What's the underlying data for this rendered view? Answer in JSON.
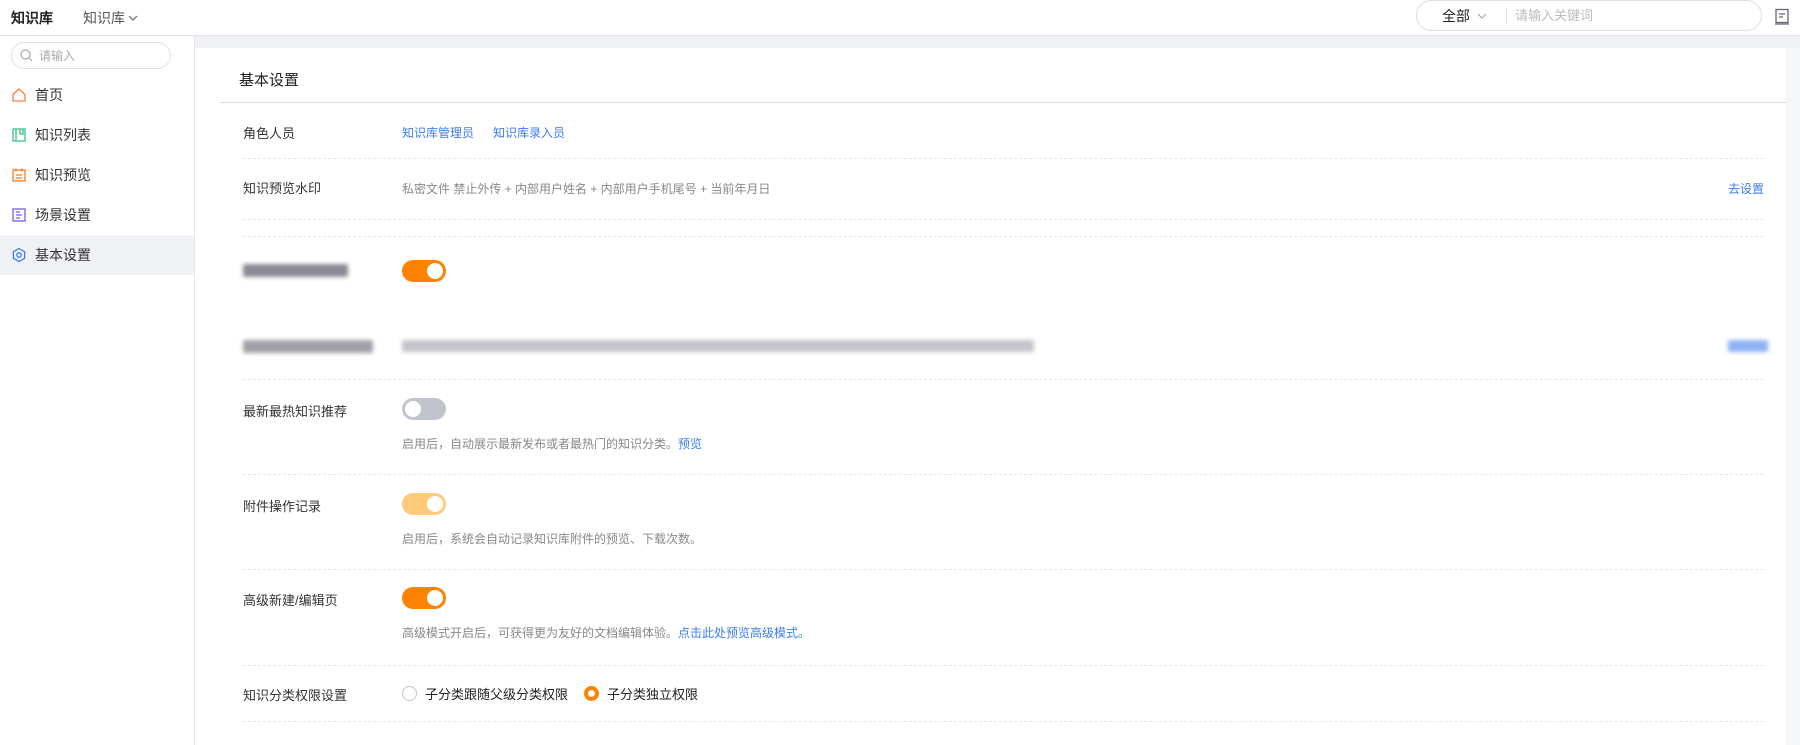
{
  "header": {
    "app_title": "知识库",
    "library_select": "知识库",
    "search_scope": "全部",
    "search_placeholder": "请输入关键词"
  },
  "sidebar": {
    "search_placeholder": "请输入",
    "items": [
      {
        "label": "首页",
        "icon": "home-icon",
        "color": "#ff7a45"
      },
      {
        "label": "知识列表",
        "icon": "list-icon",
        "color": "#3cc48a"
      },
      {
        "label": "知识预览",
        "icon": "preview-icon",
        "color": "#ff7a1a"
      },
      {
        "label": "场景设置",
        "icon": "scene-icon",
        "color": "#7a5af0"
      },
      {
        "label": "基本设置",
        "icon": "gear-icon",
        "color": "#3c7cf0",
        "active": true
      }
    ]
  },
  "main": {
    "title": "基本设置",
    "roles": {
      "label": "角色人员",
      "links": [
        "知识库管理员",
        "知识库录入员"
      ]
    },
    "watermark": {
      "label": "知识预览水印",
      "value": "私密文件 禁止外传 + 内部用户姓名 + 内部用户手机尾号 + 当前年月日",
      "action": "去设置"
    },
    "latest_hot": {
      "label": "最新最热知识推荐",
      "enabled": false,
      "desc": "启用后，自动展示最新发布或者最热门的知识分类。",
      "link": "预览"
    },
    "attachment_log": {
      "label": "附件操作记录",
      "enabled": true,
      "disabled": true,
      "desc": "启用后，系统会自动记录知识库附件的预览、下载次数。"
    },
    "advanced_editor": {
      "label": "高级新建/编辑页",
      "enabled": true,
      "desc": "高级模式开启后，可获得更为友好的文档编辑体验。",
      "link": "点击此处预览高级模式。"
    },
    "category_permission": {
      "label": "知识分类权限设置",
      "options": [
        "子分类跟随父级分类权限",
        "子分类独立权限"
      ],
      "selected": 1
    }
  },
  "colors": {
    "accent": "#ff8200",
    "accent_disabled": "#ffc97a",
    "link": "#3c7cf0",
    "toggle_off": "#c0c4cc"
  }
}
